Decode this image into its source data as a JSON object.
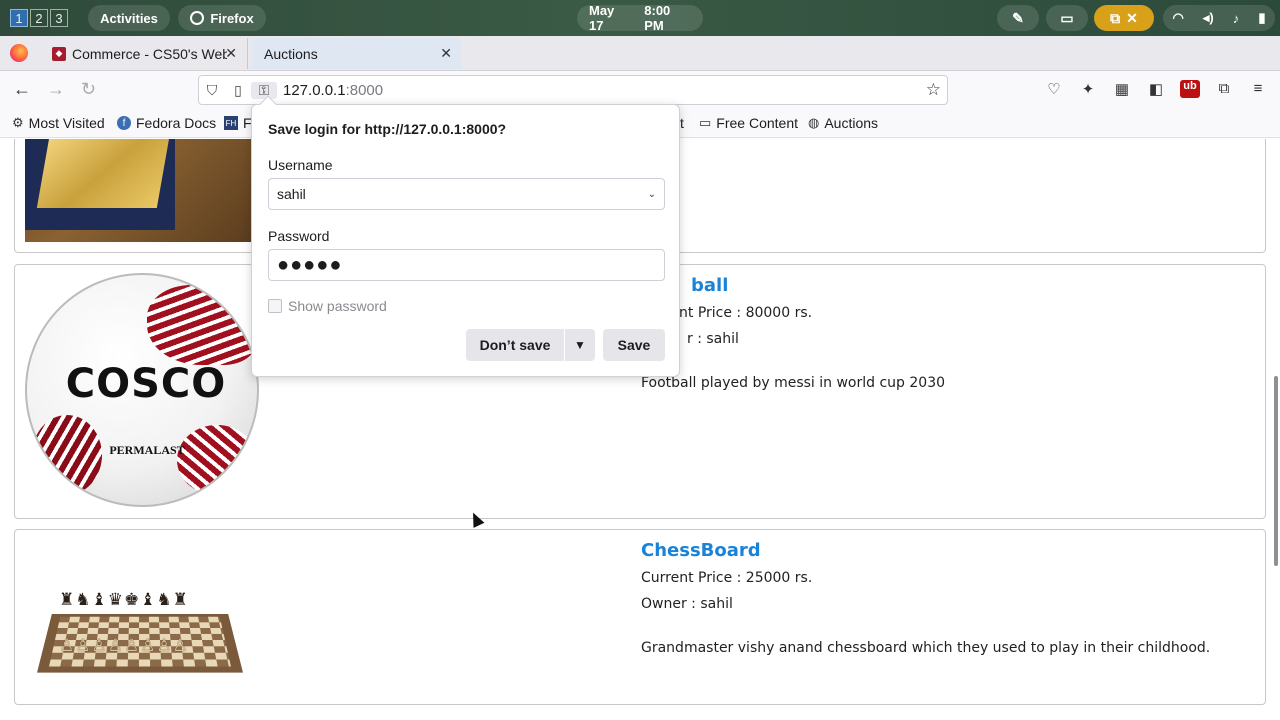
{
  "gnome": {
    "workspaces": [
      "1",
      "2",
      "3"
    ],
    "activities": "Activities",
    "app_name": "Firefox",
    "date": "May 17",
    "time": "8:00 PM"
  },
  "tabs": [
    {
      "title": "Commerce - CS50's Web"
    },
    {
      "title": "Auctions"
    }
  ],
  "url": {
    "host": "127.0.0.1",
    "port": ":8000"
  },
  "bookmarks": {
    "most_visited": "Most Visited",
    "fedora_docs": "Fedora Docs",
    "truncated_fe": "Fe",
    "truncated_t": "t",
    "free_content": "Free Content",
    "auctions": "Auctions"
  },
  "listings": [
    {
      "name": "Football",
      "name_visible": "ball",
      "price_prefix": "Current Price : ",
      "price_visible": "nt Price : 80000 rs.",
      "owner_visible": "r : sahil",
      "description": "Football played by messi in world cup 2030",
      "image_brand": "COSCO",
      "image_sub": "PERMALAST"
    },
    {
      "name": "ChessBoard",
      "price": "Current Price : 25000 rs.",
      "owner": "Owner : sahil",
      "description": "Grandmaster vishy anand chessboard which they used to play in their childhood."
    }
  ],
  "popup": {
    "title": "Save login for http://127.0.0.1:8000?",
    "username_label": "Username",
    "username_value": "sahil",
    "password_label": "Password",
    "password_masked": "●●●●●",
    "show_password": "Show password",
    "dont_save": "Don’t save",
    "save": "Save"
  }
}
